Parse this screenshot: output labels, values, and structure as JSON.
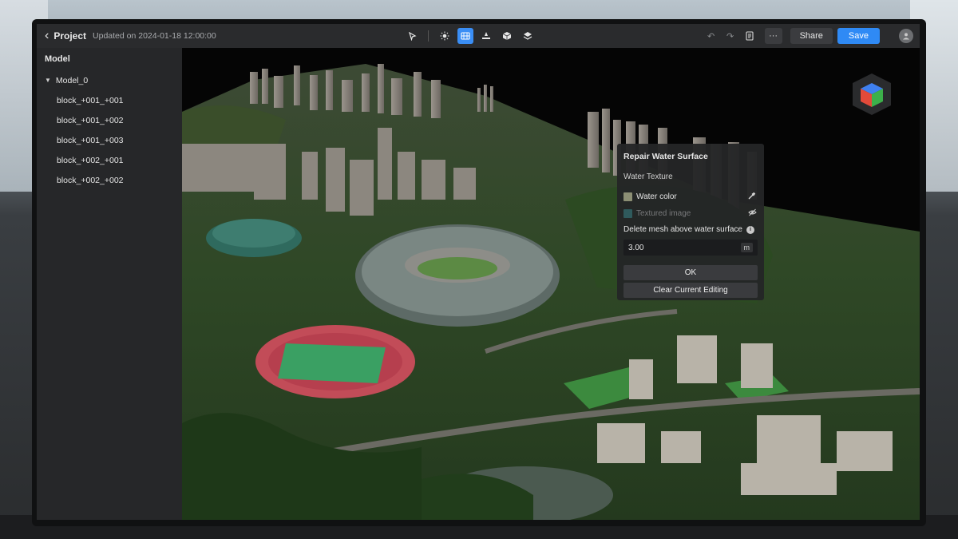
{
  "header": {
    "back_label": "Project",
    "updated_text": "Updated on 2024-01-18 12:00:00",
    "share_label": "Share",
    "save_label": "Save"
  },
  "toolbar_icons": [
    "cursor-icon",
    "sun-icon",
    "terrain-icon",
    "pin-icon",
    "cube-icon",
    "layers-icon"
  ],
  "sidebar": {
    "heading": "Model",
    "root": "Model_0",
    "items": [
      {
        "label": "block_+001_+001"
      },
      {
        "label": "block_+001_+002"
      },
      {
        "label": "block_+001_+003"
      },
      {
        "label": "block_+002_+001"
      },
      {
        "label": "block_+002_+002"
      }
    ]
  },
  "panel": {
    "title": "Repair Water Surface",
    "section_label": "Water Texture",
    "water_color_label": "Water color",
    "textured_image_label": "Textured image",
    "delete_label": "Delete mesh above water surface",
    "value": "3.00",
    "unit": "m",
    "ok_label": "OK",
    "clear_label": "Clear Current Editing"
  },
  "colors": {
    "accent": "#2f8af5",
    "water_color_swatch": "#8c8f74",
    "textured_image_swatch": "#2f5a5c"
  }
}
